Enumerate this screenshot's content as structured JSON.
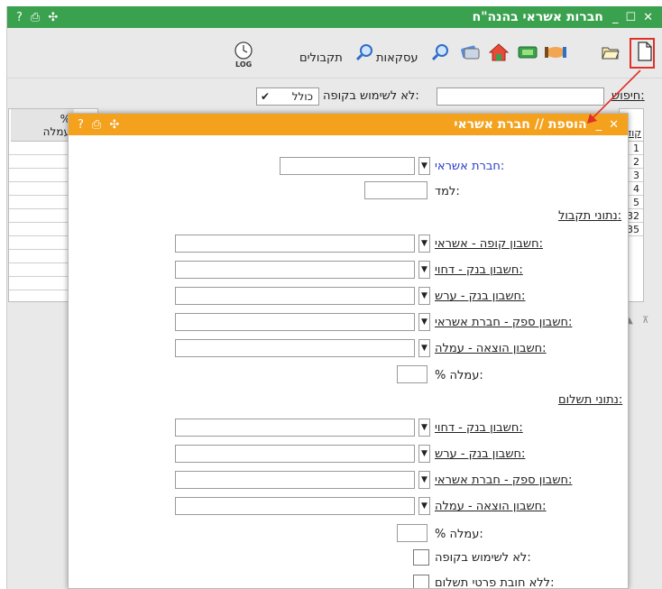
{
  "outer_window": {
    "title": "חברות אשראי בהנה\"ח",
    "controls": {
      "close": "✕",
      "maximize": "☐",
      "minimize": "_"
    },
    "tools": {
      "help": "?",
      "print": "⎙",
      "move": "✣"
    }
  },
  "toolbar": {
    "receipts_label": "תקבולים",
    "transactions_label": "עסקאות",
    "log_label": "LOG"
  },
  "search": {
    "label": "חיפוש:",
    "value": "",
    "filter_label": "לא לשימוש בקופה:",
    "filter_value": "כולל"
  },
  "background_table": {
    "fee_header_pct": "%",
    "fee_header": "עמלה",
    "code_header": "קוד",
    "codes": [
      "1",
      "2",
      "3",
      "4",
      "5",
      "32",
      "35"
    ]
  },
  "modal": {
    "title": "הוספת // חברת אשראי",
    "controls": {
      "close": "✕",
      "minimize": "_"
    },
    "tools": {
      "help": "?",
      "print": "⎙",
      "move": "✣"
    },
    "credit_company_label": "חברת אשראי:",
    "study_label": "למד:",
    "receipt_section": "נתוני תקבול:",
    "receipt_fields": [
      {
        "label": "חשבון קופה - אשראי:"
      },
      {
        "label": "חשבון בנק - דחוי:"
      },
      {
        "label": "חשבון בנק - ערש:"
      },
      {
        "label": "חשבון ספק - חברת אשראי:"
      },
      {
        "label": "חשבון הוצאה - עמלה:"
      }
    ],
    "receipt_fee_label": "% עמלה:",
    "payment_section": "נתוני תשלום:",
    "payment_fields": [
      {
        "label": "חשבון בנק - דחוי:"
      },
      {
        "label": "חשבון בנק - ערש:"
      },
      {
        "label": "חשבון ספק - חברת אשראי:"
      },
      {
        "label": "חשבון הוצאה - עמלה:"
      }
    ],
    "payment_fee_label": "% עמלה:",
    "not_for_pos_label": "לא לשימוש בקופה:",
    "no_payment_details_label": "ללא חובת פרטי תשלום:"
  },
  "colors": {
    "outer_title": "#3aa14f",
    "modal_title": "#f4a21d",
    "annotation": "#e0302a",
    "link_blue": "#2a3cc7"
  }
}
